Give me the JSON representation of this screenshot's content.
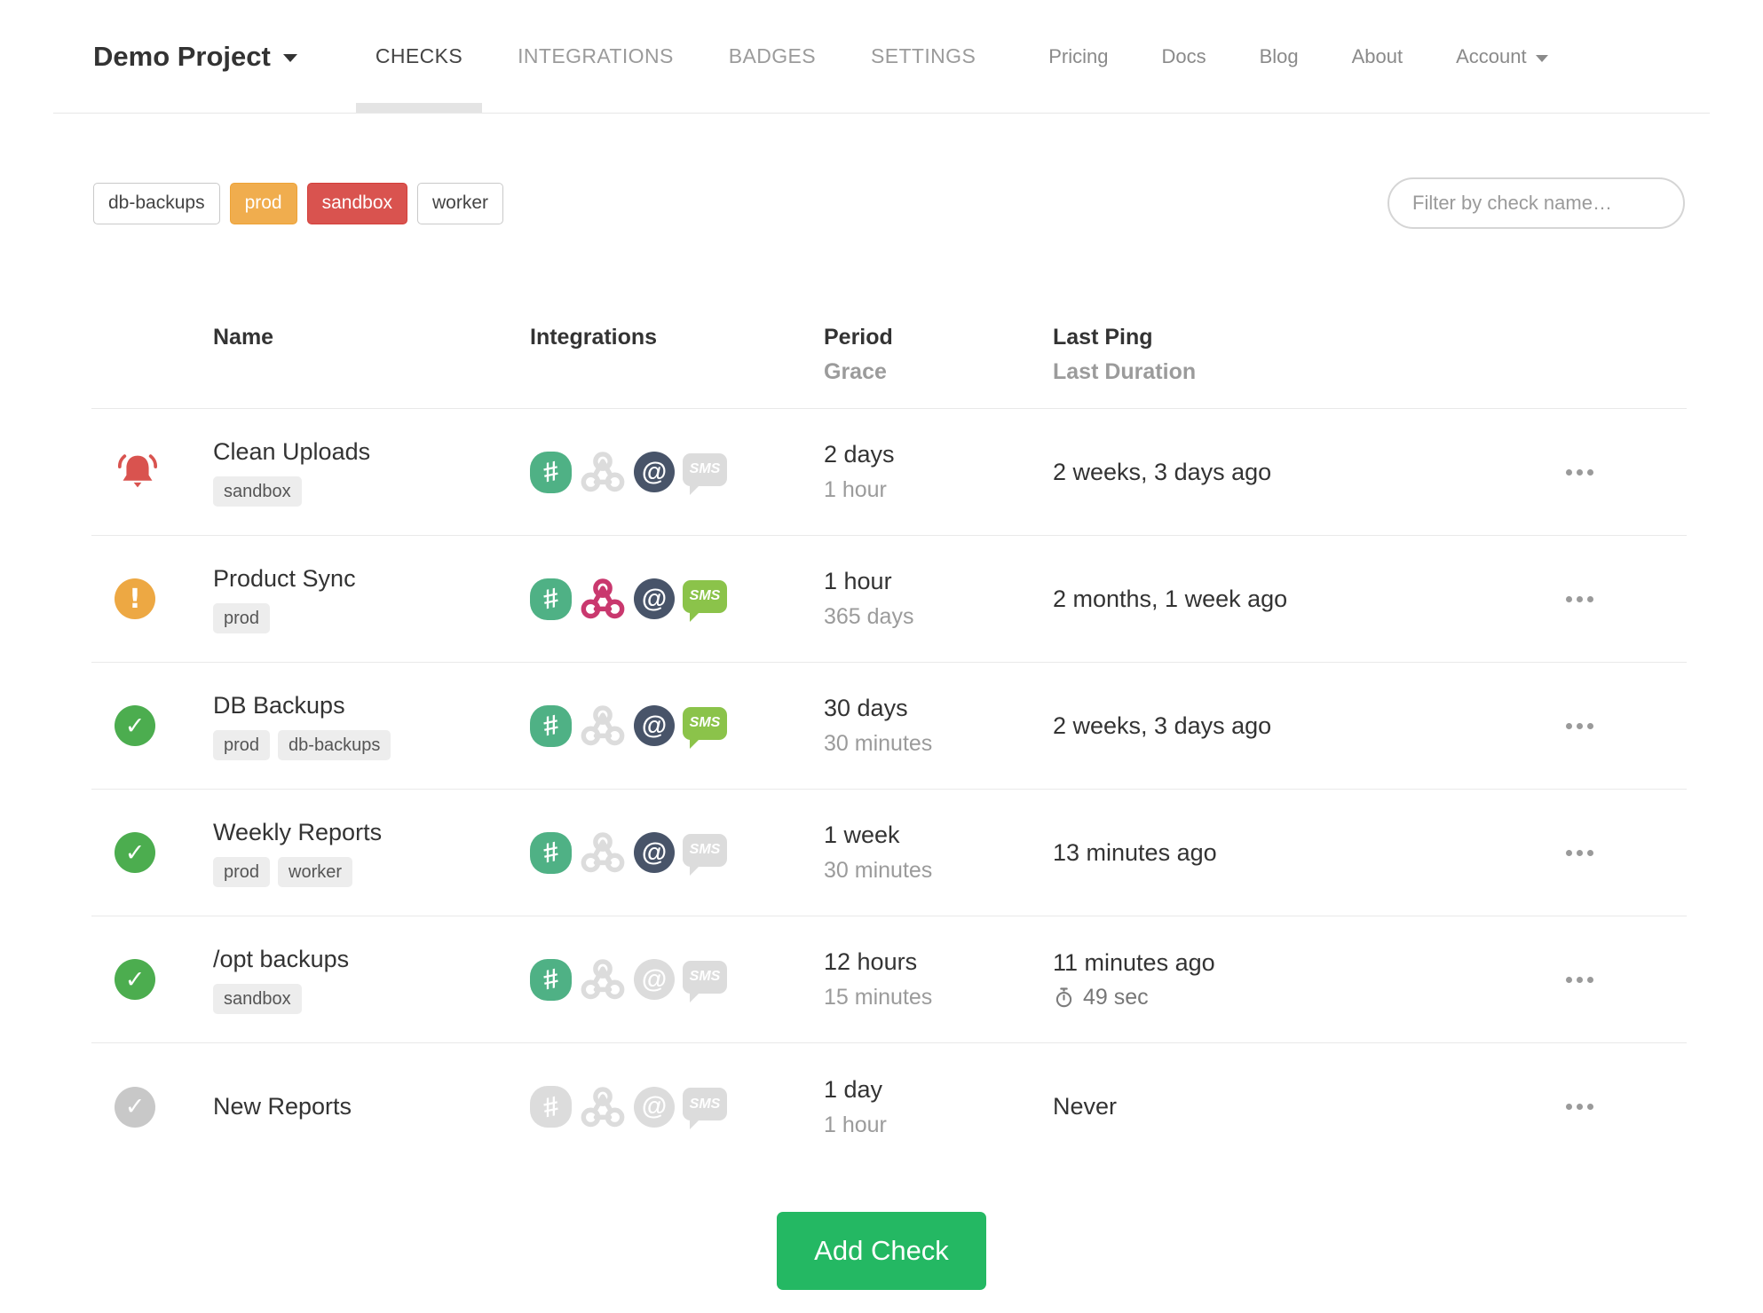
{
  "nav": {
    "project_name": "Demo Project",
    "tabs": [
      {
        "label": "CHECKS",
        "active": true
      },
      {
        "label": "INTEGRATIONS",
        "active": false
      },
      {
        "label": "BADGES",
        "active": false
      },
      {
        "label": "SETTINGS",
        "active": false
      }
    ],
    "links": [
      "Pricing",
      "Docs",
      "Blog",
      "About"
    ],
    "account_label": "Account"
  },
  "filters": {
    "tags": [
      {
        "label": "db-backups",
        "style": "default"
      },
      {
        "label": "prod",
        "style": "warning"
      },
      {
        "label": "sandbox",
        "style": "danger"
      },
      {
        "label": "worker",
        "style": "default"
      }
    ],
    "search_placeholder": "Filter by check name…"
  },
  "table": {
    "headers": {
      "name": "Name",
      "integrations": "Integrations",
      "period": "Period",
      "grace": "Grace",
      "last_ping": "Last Ping",
      "last_duration": "Last Duration"
    }
  },
  "checks": [
    {
      "name": "Clean Uploads",
      "status": "alert",
      "tags": [
        "sandbox"
      ],
      "integrations": {
        "slack": "active",
        "webhook": "faded",
        "email": "active",
        "sms": "faded"
      },
      "period": "2 days",
      "grace": "1 hour",
      "last_ping": "2 weeks, 3 days ago",
      "last_duration": ""
    },
    {
      "name": "Product Sync",
      "status": "warn",
      "tags": [
        "prod"
      ],
      "integrations": {
        "slack": "active",
        "webhook": "active",
        "email": "active",
        "sms": "active"
      },
      "period": "1 hour",
      "grace": "365 days",
      "last_ping": "2 months, 1 week ago",
      "last_duration": ""
    },
    {
      "name": "DB Backups",
      "status": "ok",
      "tags": [
        "prod",
        "db-backups"
      ],
      "integrations": {
        "slack": "active",
        "webhook": "faded",
        "email": "active",
        "sms": "active"
      },
      "period": "30 days",
      "grace": "30 minutes",
      "last_ping": "2 weeks, 3 days ago",
      "last_duration": ""
    },
    {
      "name": "Weekly Reports",
      "status": "ok",
      "tags": [
        "prod",
        "worker"
      ],
      "integrations": {
        "slack": "active",
        "webhook": "faded",
        "email": "active",
        "sms": "faded"
      },
      "period": "1 week",
      "grace": "30 minutes",
      "last_ping": "13 minutes ago",
      "last_duration": ""
    },
    {
      "name": "/opt backups",
      "status": "ok",
      "tags": [
        "sandbox"
      ],
      "integrations": {
        "slack": "active",
        "webhook": "faded",
        "email": "faded",
        "sms": "faded"
      },
      "period": "12 hours",
      "grace": "15 minutes",
      "last_ping": "11 minutes ago",
      "last_duration": "49 sec"
    },
    {
      "name": "New Reports",
      "status": "new",
      "tags": [],
      "integrations": {
        "slack": "faded",
        "webhook": "faded",
        "email": "faded",
        "sms": "faded"
      },
      "period": "1 day",
      "grace": "1 hour",
      "last_ping": "Never",
      "last_duration": ""
    }
  ],
  "glyphs": {
    "slack": "#",
    "email": "@",
    "sms": "SMS"
  },
  "add_check_label": "Add Check",
  "colors": {
    "alert_red": "#d9534f",
    "warn_orange": "#eda843",
    "ok_green": "#4cad4f",
    "new_gray": "#c8c8c8",
    "slack_green": "#4fb185",
    "webhook_crimson": "#c9386e",
    "email_slate": "#485469",
    "sms_green": "#8bc34a",
    "faded_gray": "#dcdcdc",
    "add_button_green": "#24b863",
    "tag_warning_bg": "#f0ad4e",
    "tag_danger_bg": "#d9534f"
  }
}
